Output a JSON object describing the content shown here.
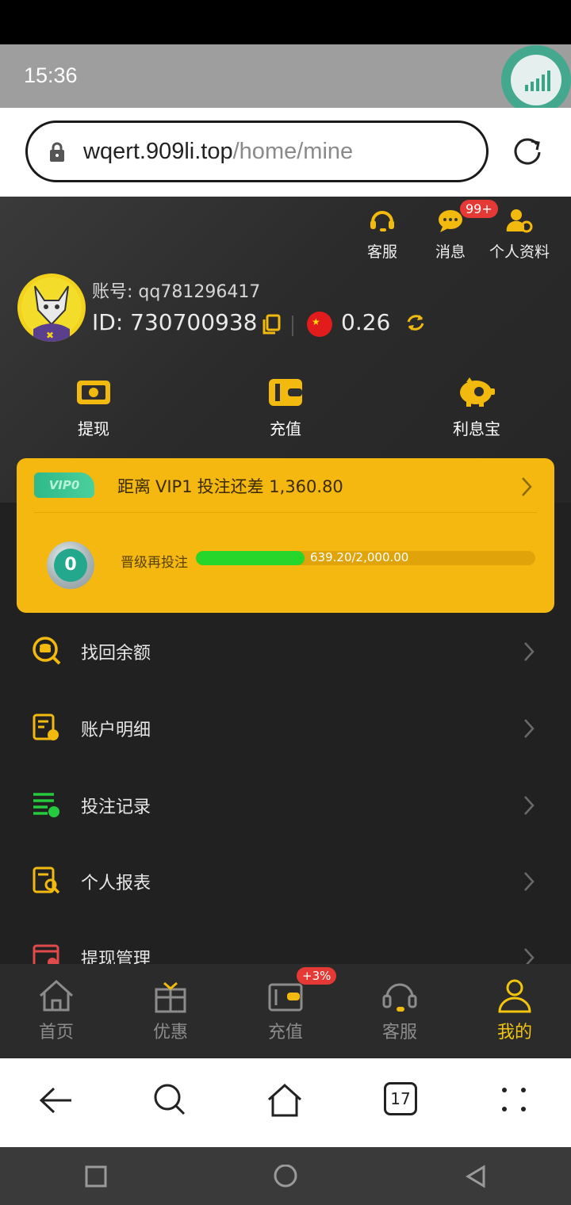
{
  "status_bar": {
    "time": "15:36"
  },
  "browser": {
    "url_domain": "wqert.909li.top",
    "url_path": "/home/mine"
  },
  "header": {
    "actions": [
      {
        "label": "客服",
        "icon": "headset-icon"
      },
      {
        "label": "消息",
        "icon": "chat-icon",
        "badge": "99+"
      },
      {
        "label": "个人资料",
        "icon": "profile-settings-icon"
      }
    ]
  },
  "profile": {
    "account_label": "账号: qq781296417",
    "id_label": "ID: 730700938",
    "balance": "0.26",
    "currency_flag": "china-flag-icon"
  },
  "quick_actions": [
    {
      "label": "提现",
      "icon": "withdraw-icon"
    },
    {
      "label": "充值",
      "icon": "wallet-icon"
    },
    {
      "label": "利息宝",
      "icon": "piggy-bank-icon"
    }
  ],
  "vip": {
    "tag": "VIP0",
    "distance_prefix": "距离",
    "next_level": "VIP1",
    "distance_suffix": "投注还差",
    "distance_amount": "1,360.80",
    "medal_level": "0",
    "medal_label": "VIP",
    "upgrade_label": "晋级再投注",
    "progress_text": "639.20/2,000.00",
    "progress_fraction": 0.3196
  },
  "menu": [
    {
      "label": "找回余额",
      "icon": "coin-search-icon",
      "color": "#f2b90f"
    },
    {
      "label": "账户明细",
      "icon": "account-detail-icon",
      "color": "#f2b90f"
    },
    {
      "label": "投注记录",
      "icon": "bet-record-icon",
      "color": "#27c93f"
    },
    {
      "label": "个人报表",
      "icon": "report-search-icon",
      "color": "#f2b90f"
    },
    {
      "label": "提现管理",
      "icon": "withdraw-manage-icon",
      "color": "#e04a4a"
    }
  ],
  "tabbar": {
    "items": [
      {
        "label": "首页",
        "icon": "home-icon"
      },
      {
        "label": "优惠",
        "icon": "gift-icon"
      },
      {
        "label": "充值",
        "icon": "wallet-icon",
        "badge": "+3%"
      },
      {
        "label": "客服",
        "icon": "headset-icon"
      },
      {
        "label": "我的",
        "icon": "user-icon",
        "active": true
      }
    ]
  },
  "browser_nav": {
    "tabs_count": "17"
  },
  "colors": {
    "accent": "#f2c50e",
    "vip_card": "#f5b811",
    "progress": "#26d62a",
    "background": "#212121"
  }
}
